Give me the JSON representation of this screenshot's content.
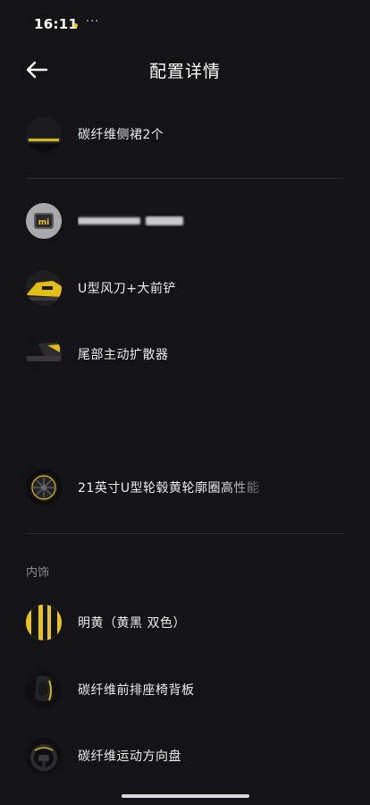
{
  "status_bar": {
    "time": "16:11",
    "more": "···"
  },
  "header": {
    "title": "配置详情",
    "back_icon": "arrow-left-icon"
  },
  "items": [
    {
      "label": "碳纤维侧裙2个",
      "thumb": "carbon-side-skirt-thumb"
    },
    {
      "label": "",
      "thumb": "xiaomi-badge-thumb",
      "blurred": true
    },
    {
      "label": "U型风刀+大前铲",
      "thumb": "front-splitter-thumb"
    },
    {
      "label": "尾部主动扩散器",
      "thumb": "rear-diffuser-thumb"
    },
    {
      "label": "21英寸U型轮毂黄轮廓圈高性能",
      "thumb": "wheel-thumb"
    }
  ],
  "interior": {
    "section_title": "内饰",
    "items": [
      {
        "label": "明黄（黄黑 双色）",
        "thumb": "yellow-black-stripe-thumb"
      },
      {
        "label": "碳纤维前排座椅背板",
        "thumb": "seat-back-thumb"
      },
      {
        "label": "碳纤维运动方向盘",
        "thumb": "steering-wheel-thumb"
      }
    ]
  },
  "colors": {
    "background": "#141418",
    "accent_yellow": "#e8c81a",
    "text": "#ececec",
    "divider": "#2a2a30"
  }
}
